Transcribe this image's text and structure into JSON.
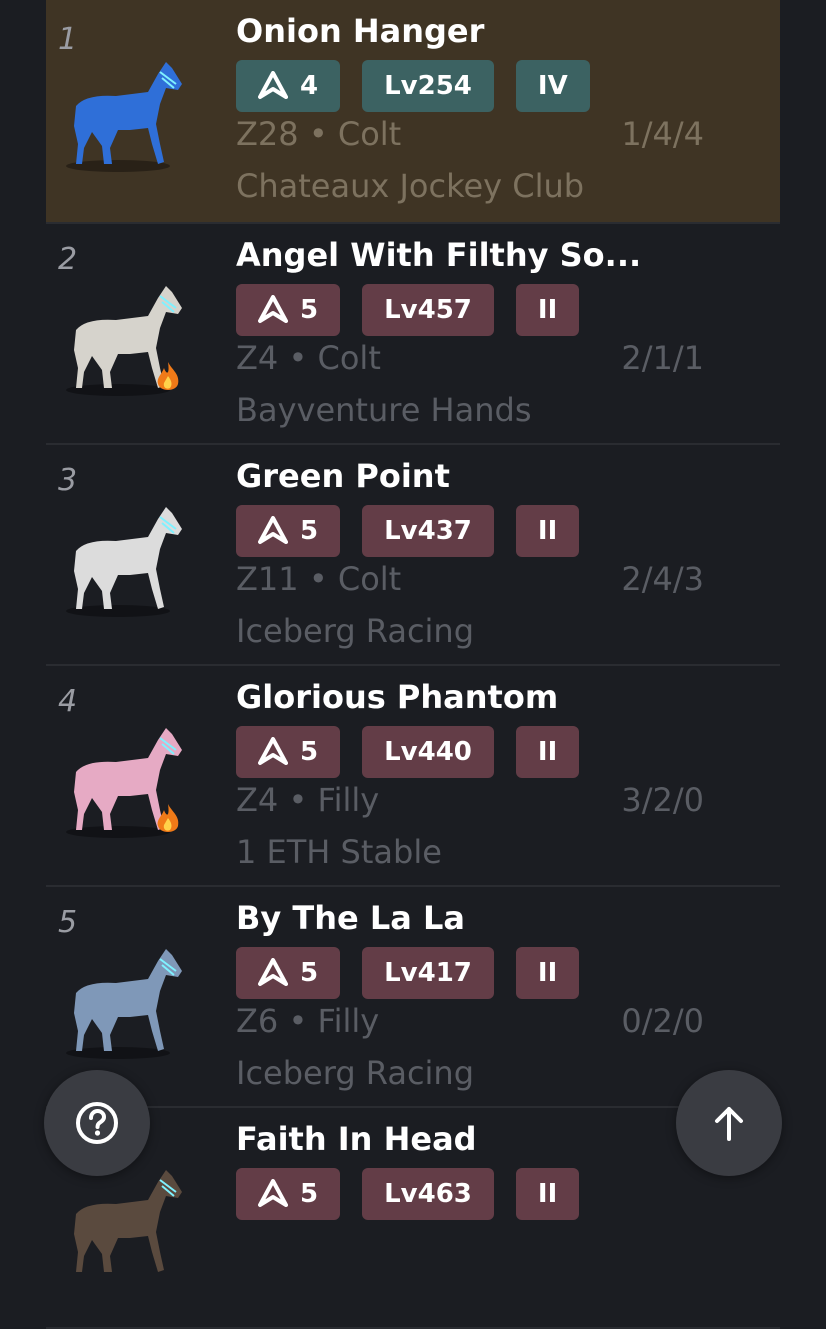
{
  "horses": [
    {
      "rank": "1",
      "name": "Onion Hanger",
      "class": "4",
      "level": "Lv254",
      "tier": "IV",
      "zone": "Z28",
      "gender": "Colt",
      "record": "1/4/4",
      "stable": "Chateaux Jockey Club",
      "coat": "#2f6fd8",
      "flame": false
    },
    {
      "rank": "2",
      "name": "Angel With Filthy So...",
      "class": "5",
      "level": "Lv457",
      "tier": "II",
      "zone": "Z4",
      "gender": "Colt",
      "record": "2/1/1",
      "stable": "Bayventure Hands",
      "coat": "#d6d3cc",
      "flame": true
    },
    {
      "rank": "3",
      "name": "Green Point",
      "class": "5",
      "level": "Lv437",
      "tier": "II",
      "zone": "Z11",
      "gender": "Colt",
      "record": "2/4/3",
      "stable": "Iceberg Racing",
      "coat": "#dcdcdc",
      "flame": false
    },
    {
      "rank": "4",
      "name": "Glorious Phantom",
      "class": "5",
      "level": "Lv440",
      "tier": "II",
      "zone": "Z4",
      "gender": "Filly",
      "record": "3/2/0",
      "stable": "1 ETH Stable",
      "coat": "#e6aac4",
      "flame": true
    },
    {
      "rank": "5",
      "name": "By The La La",
      "class": "5",
      "level": "Lv417",
      "tier": "II",
      "zone": "Z6",
      "gender": "Filly",
      "record": "0/2/0",
      "stable": "Iceberg Racing",
      "coat": "#7f98b8",
      "flame": false
    },
    {
      "rank": "",
      "name": "Faith In Head",
      "class": "5",
      "level": "Lv463",
      "tier": "II",
      "zone": "",
      "gender": "",
      "record": "",
      "stable": "",
      "coat": "#5a4a3e",
      "flame": false
    }
  ],
  "colors": {
    "accent_first": "#3c6262",
    "badge": "#633d47",
    "first_row_bg": "#3f3424"
  },
  "buttons": {
    "help_icon": "help-icon",
    "up_icon": "arrow-up-icon"
  }
}
